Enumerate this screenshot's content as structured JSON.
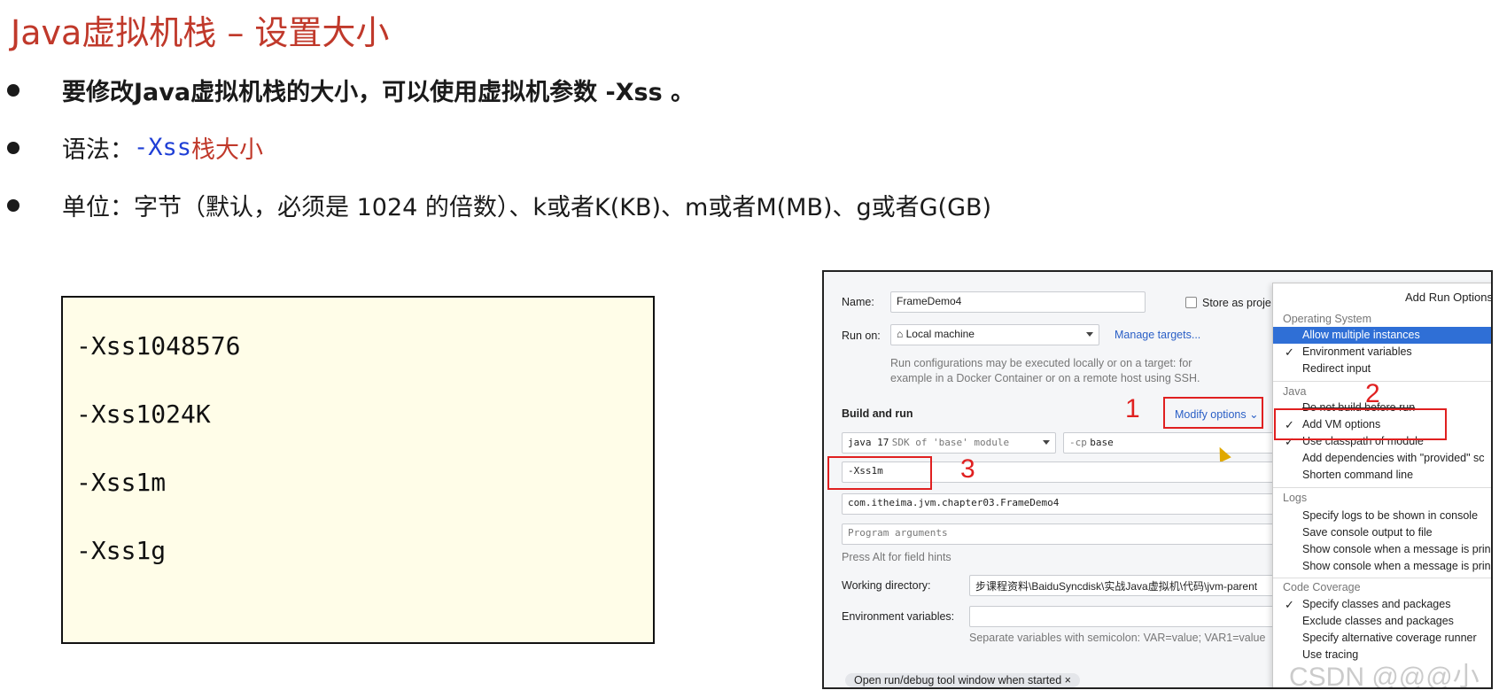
{
  "slide": {
    "title": "Java虚拟机栈 – 设置大小",
    "bullet1": "要修改Java虚拟机栈的大小，可以使用虚拟机参数 -Xss 。",
    "bullet2_prefix": "语法：",
    "bullet2_code": "-Xss",
    "bullet2_suffix": "栈大小",
    "bullet3": "单位：字节（默认，必须是 1024 的倍数）、k或者K(KB)、m或者M(MB)、g或者G(GB)"
  },
  "code_examples": [
    "-Xss1048576",
    "-Xss1024K",
    "-Xss1m",
    "-Xss1g"
  ],
  "ide": {
    "name_label": "Name:",
    "name_value": "FrameDemo4",
    "store_label": "Store as proje",
    "run_on_label": "Run on:",
    "run_on_value": "Local machine",
    "manage_targets": "Manage targets...",
    "run_hint_1": "Run configurations may be executed locally or on a target: for",
    "run_hint_2": "example in a Docker Container or on a remote host using SSH.",
    "build_and_run": "Build and run",
    "modify_options": "Modify options",
    "sdk_value": "java 17",
    "sdk_hint": "SDK of 'base' module",
    "cp_prefix": "-cp",
    "cp_value": "base",
    "vm_options": "-Xss1m",
    "main_class": "com.itheima.jvm.chapter03.FrameDemo4",
    "program_args_placeholder": "Program arguments",
    "press_alt_hint": "Press Alt for field hints",
    "working_dir_label": "Working directory:",
    "working_dir_value": "步课程资料\\BaiduSyncdisk\\实战Java虚拟机\\代码\\jvm-parent",
    "env_vars_label": "Environment variables:",
    "env_vars_hint": "Separate variables with semicolon: VAR=value; VAR1=value",
    "open_tool_window": "Open run/debug tool window when started",
    "annotations": [
      "1",
      "2",
      "3"
    ]
  },
  "menu": {
    "title": "Add Run Options",
    "sections": [
      {
        "label": "Operating System",
        "items": [
          {
            "label": "Allow multiple instances",
            "checked": false,
            "selected": true
          },
          {
            "label": "Environment variables",
            "checked": true,
            "selected": false
          },
          {
            "label": "Redirect input",
            "checked": false,
            "selected": false
          }
        ]
      },
      {
        "label": "Java",
        "items": [
          {
            "label": "Do not build before run",
            "checked": false,
            "selected": false
          },
          {
            "label": "Add VM options",
            "checked": true,
            "selected": false
          },
          {
            "label": "Use classpath of module",
            "checked": true,
            "selected": false
          },
          {
            "label": "Add dependencies with \"provided\" sc",
            "checked": false,
            "selected": false
          },
          {
            "label": "Shorten command line",
            "checked": false,
            "selected": false
          }
        ]
      },
      {
        "label": "Logs",
        "items": [
          {
            "label": "Specify logs to be shown in console",
            "checked": false,
            "selected": false
          },
          {
            "label": "Save console output to file",
            "checked": false,
            "selected": false
          },
          {
            "label": "Show console when a message is prin",
            "checked": false,
            "selected": false
          },
          {
            "label": "Show console when a message is prin",
            "checked": false,
            "selected": false
          }
        ]
      },
      {
        "label": "Code Coverage",
        "items": [
          {
            "label": "Specify classes and packages",
            "checked": true,
            "selected": false
          },
          {
            "label": "Exclude classes and packages",
            "checked": false,
            "selected": false
          },
          {
            "label": "Specify alternative coverage runner",
            "checked": false,
            "selected": false
          },
          {
            "label": "Use tracing",
            "checked": false,
            "selected": false
          }
        ]
      }
    ]
  },
  "watermark": "CSDN @@@小 k",
  "colors": {
    "title_red": "#c0392b",
    "code_blue": "#1f3fd6",
    "annotation_red": "#e02020",
    "menu_selected": "#2f6fd6",
    "code_box_bg": "#fffde8"
  }
}
